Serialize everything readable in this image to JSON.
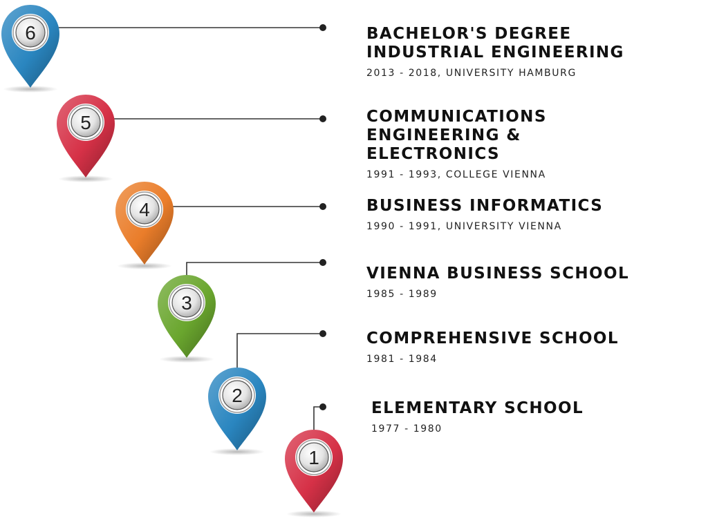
{
  "colors": {
    "blue": "#2a86c0",
    "red": "#d63147",
    "orange": "#ea7d2a",
    "green": "#6aa62e",
    "connector": "#333333"
  },
  "entries": [
    {
      "number": "6",
      "color": "blue",
      "title": "BACHELOR'S DEGREE\nINDUSTRIAL ENGINEERING",
      "detail": "2013 - 2018, UNIVERSITY HAMBURG"
    },
    {
      "number": "5",
      "color": "red",
      "title": "COMMUNICATIONS\nENGINEERING &\nELECTRONICS",
      "detail": "1991 - 1993, COLLEGE VIENNA"
    },
    {
      "number": "4",
      "color": "orange",
      "title": "BUSINESS INFORMATICS",
      "detail": "1990 - 1991, UNIVERSITY VIENNA"
    },
    {
      "number": "3",
      "color": "green",
      "title": "VIENNA BUSINESS SCHOOL",
      "detail": "1985 - 1989"
    },
    {
      "number": "2",
      "color": "blue",
      "title": "COMPREHENSIVE SCHOOL",
      "detail": "1981 - 1984"
    },
    {
      "number": "1",
      "color": "red",
      "title": "ELEMENTARY SCHOOL",
      "detail": "1977 - 1980"
    }
  ]
}
